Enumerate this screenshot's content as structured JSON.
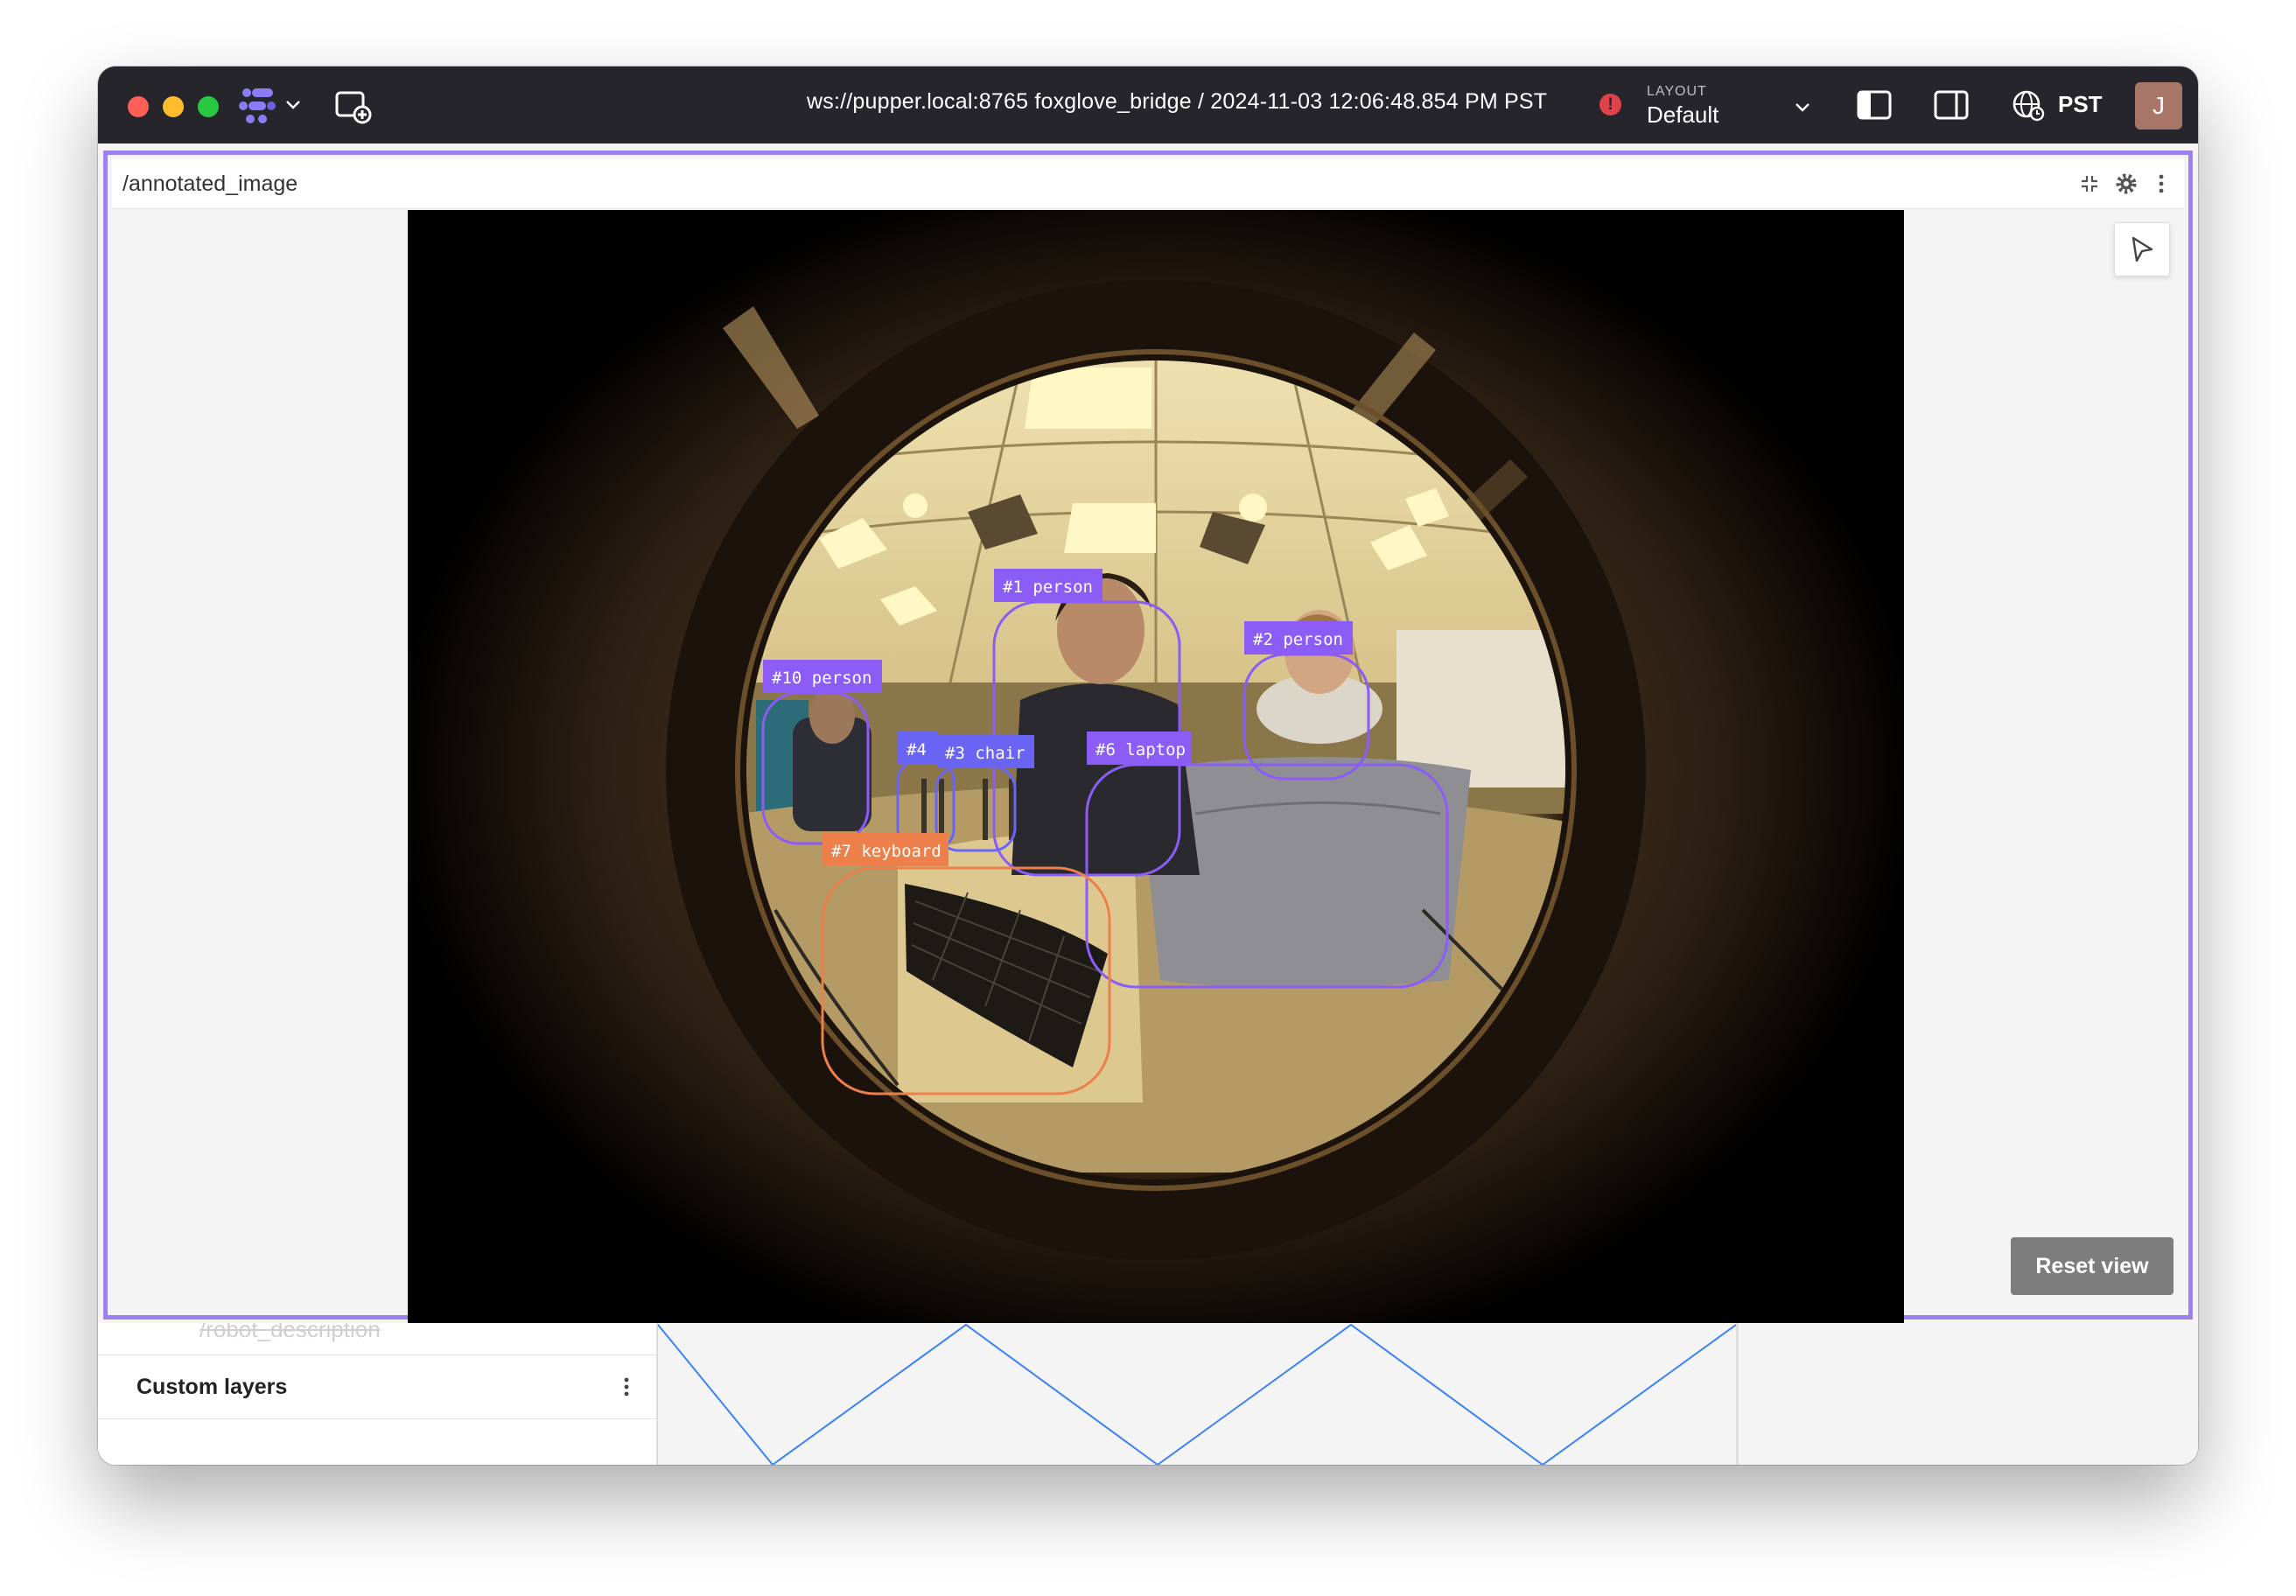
{
  "titlebar": {
    "connection": "ws://pupper.local:8765 foxglove_bridge / 2024-11-03 12:06:48.854 PM PST",
    "alert_icon": "alert-circle-icon",
    "layout_label": "LAYOUT",
    "layout_value": "Default",
    "timezone": "PST",
    "avatar_initial": "J"
  },
  "panel": {
    "title": "/annotated_image",
    "reset_label": "Reset view",
    "detections": [
      {
        "label": "#1 person",
        "color": "#8b5cf6"
      },
      {
        "label": "#2 person",
        "color": "#8b5cf6"
      },
      {
        "label": "#10 person",
        "color": "#8b5cf6"
      },
      {
        "label": "#4",
        "color": "#6a64f5"
      },
      {
        "label": "#3 chair",
        "color": "#6a64f5"
      },
      {
        "label": "#6 laptop",
        "color": "#8b5cf6"
      },
      {
        "label": "#7 keyboard",
        "color": "#ec7f4a"
      }
    ]
  },
  "bottom": {
    "faded_item": "/robot_description",
    "custom_layers_label": "Custom layers"
  },
  "colors": {
    "accent": "#9b82f0",
    "titlebar": "#25252b",
    "plot_line": "#3b82f6"
  }
}
